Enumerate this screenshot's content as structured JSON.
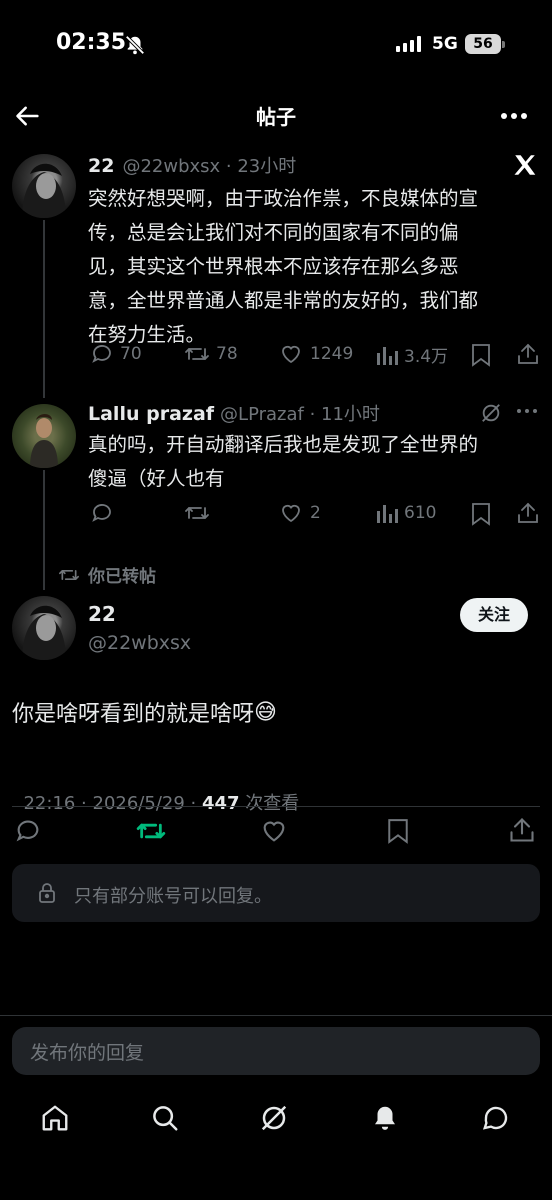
{
  "status": {
    "time": "02:35",
    "network": "5G",
    "battery": "56"
  },
  "header": {
    "title": "帖子"
  },
  "tweet1": {
    "name": "22",
    "handle_time": "@22wbxsx · 23小时",
    "lines": [
      "突然好想哭啊，由于政治作祟，不良媒体的宣",
      "传，总是会让我们对不同的国家有不同的偏",
      "见，其实这个世界根本不应该存在那么多恶",
      "意，全世界普通人都是非常的友好的，我们都",
      "在努力生活。"
    ],
    "replies": "70",
    "reposts": "78",
    "likes": "1249",
    "views": "3.4万"
  },
  "tweet2": {
    "name": "Lallu prazaf",
    "handle_time": "@LPrazaf · 11小时",
    "lines": [
      "真的吗，开自动翻译后我也是发现了全世界的",
      "傻逼（好人也有"
    ],
    "likes": "2",
    "views": "610"
  },
  "repost_note": "你已转帖",
  "main": {
    "name": "22",
    "handle": "@22wbxsx",
    "follow_label": "关注",
    "text": "你是啥呀看到的就是啥呀",
    "emoji": "😅",
    "meta_prefix": "22:16 · 2026/5/29 · ",
    "views": "447",
    "views_suffix": " 次查看"
  },
  "reply_restriction": "只有部分账号可以回复。",
  "compose_placeholder": "发布你的回复",
  "colors": {
    "background": "#000000",
    "repost_active": "#00ba7c",
    "muted": "#71767b"
  }
}
